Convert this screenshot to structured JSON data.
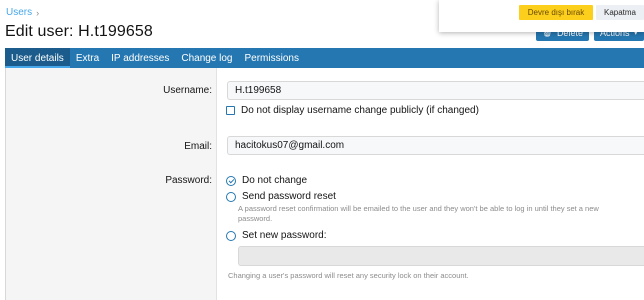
{
  "breadcrumb": {
    "item": "Users",
    "separator": "›"
  },
  "page_title": "Edit user: H.t199658",
  "header_buttons": {
    "delete": "Delete",
    "actions": "Actions",
    "actions_caret": "▾"
  },
  "notice": {
    "primary_button": "Devre dışı bırak",
    "secondary_button": "Kapatma"
  },
  "tabs": [
    {
      "label": "User details",
      "active": true
    },
    {
      "label": "Extra",
      "active": false
    },
    {
      "label": "IP addresses",
      "active": false
    },
    {
      "label": "Change log",
      "active": false
    },
    {
      "label": "Permissions",
      "active": false
    }
  ],
  "form": {
    "username_label": "Username:",
    "username_value": "H.t199658",
    "hide_change_label": "Do not display username change publicly (if changed)",
    "email_label": "Email:",
    "email_value": "hacitokus07@gmail.com",
    "password_label": "Password:",
    "options": {
      "no_change": "Do not change",
      "send_reset": "Send password reset",
      "send_reset_hint_1": "A password reset confirmation will be emailed to the user and they won't be able to log in until they set a new",
      "send_reset_hint_2": "password.",
      "set_new": "Set new password:"
    },
    "security_note": "Changing a user's password will reset any security lock on their account."
  },
  "colors": {
    "accent": "#2577b1",
    "tab_active": "#1b5c8c",
    "link": "#47a7eb",
    "notice_button": "#fccf1c"
  }
}
